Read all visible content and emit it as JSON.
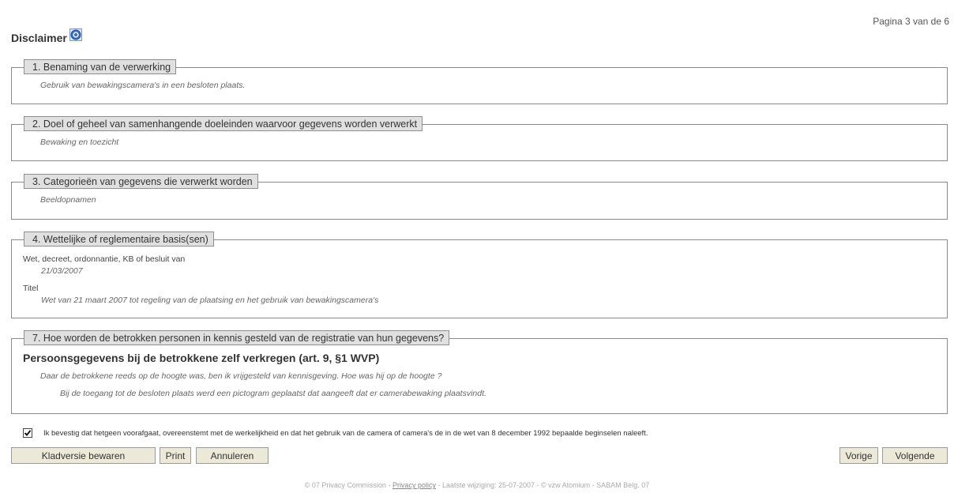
{
  "header": {
    "pagina": "Pagina 3 van de 6",
    "title": "Disclaimer",
    "help_icon": "help-icon"
  },
  "sections": [
    {
      "legend": "1. Benaming van de verwerking",
      "text": "Gebruik van bewakingscamera's in een besloten plaats."
    },
    {
      "legend": "2. Doel of geheel van samenhangende doeleinden waarvoor gegevens worden verwerkt",
      "text": "Bewaking en toezicht"
    },
    {
      "legend": "3. Categorieën van gegevens die verwerkt worden",
      "text": "Beeldopnamen"
    },
    {
      "legend": "4. Wettelijke of reglementaire basis(sen)",
      "label1": "Wet, decreet, ordonnantie, KB of besluit van",
      "value1": "21/03/2007",
      "label2": "Titel",
      "value2": "Wet van 21 maart 2007 tot regeling van de plaatsing en het gebruik van bewakingscamera's"
    },
    {
      "legend": "7. Hoe worden de betrokken personen in kennis gesteld van de registratie van hun gegevens?",
      "heading": "Persoonsgegevens bij de betrokkene zelf verkregen (art. 9, §1 WVP)",
      "line1": "Daar de betrokkene reeds op de hoogte was, ben ik vrijgesteld van kennisgeving. Hoe was hij op de hoogte ?",
      "line2": "Bij de toegang tot de besloten plaats werd een pictogram geplaatst dat aangeeft dat er camerabewaking plaatsvindt."
    }
  ],
  "confirm": {
    "checked": true,
    "text": "Ik bevestig dat hetgeen voorafgaat, overeenstemt met de werkelijkheid en dat het gebruik van de camera of camera's de in de wet van 8 december 1992 bepaalde beginselen naleeft."
  },
  "buttons": {
    "save_draft": "Kladversie bewaren",
    "print": "Print",
    "cancel": "Annuleren",
    "previous": "Vorige",
    "next": "Volgende"
  },
  "footer": {
    "left": "© 07 Privacy Commission - ",
    "link": "Privacy policy",
    "right": " - Laatste wijziging: 25-07-2007 - © vzw Atomium - SABAM Belg. 07"
  },
  "colors": {
    "legend_bg": "#e0e0e0",
    "button_bg": "#ece9d8",
    "border": "#8a8a8a"
  }
}
